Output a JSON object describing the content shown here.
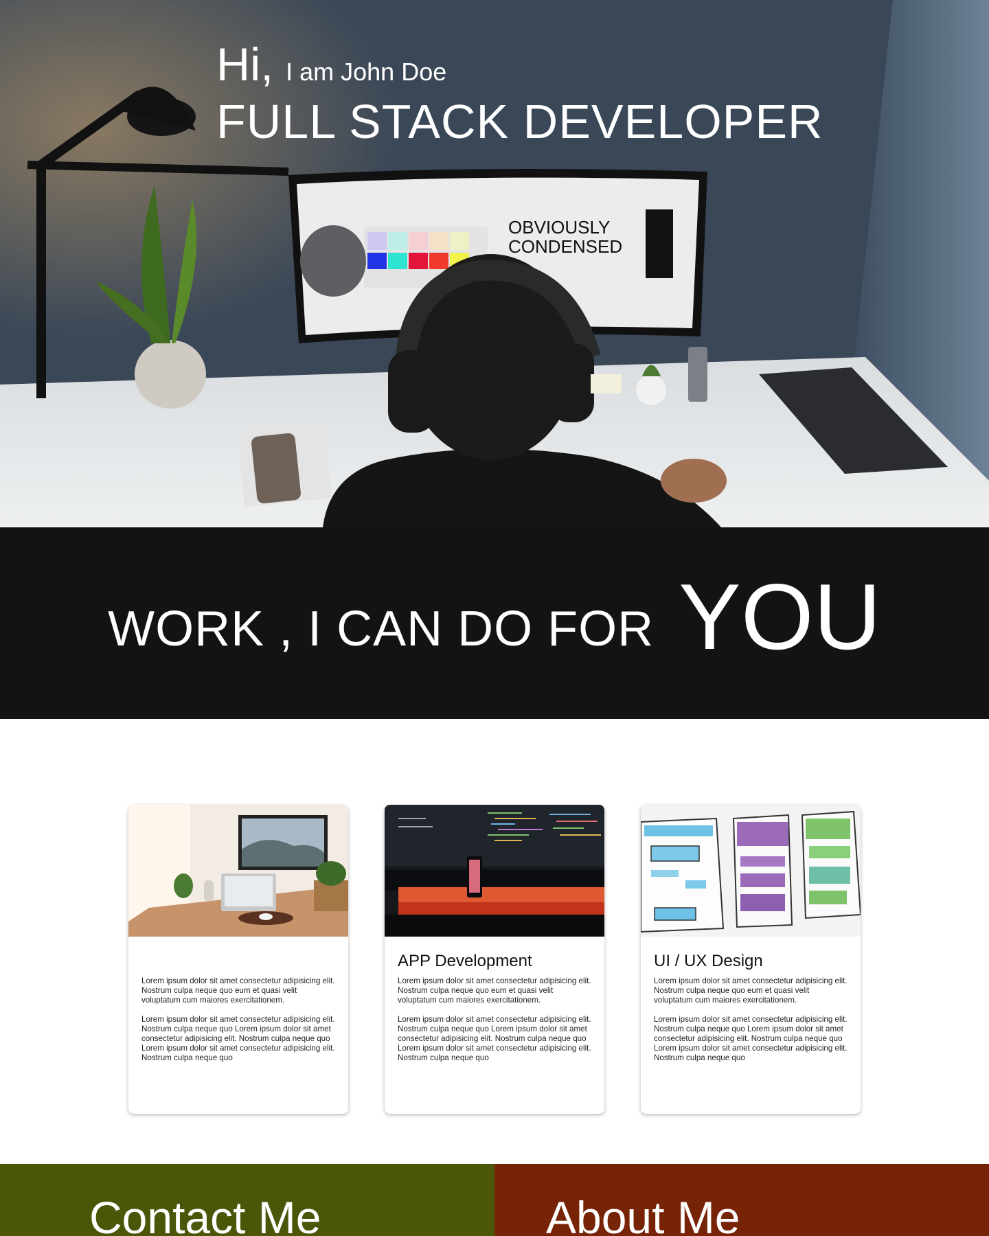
{
  "hero": {
    "hi": "Hi,",
    "name_line": "I am John Doe",
    "role": "FULL STACK DEVELOPER",
    "screen_text_line1": "OBVIOUSLY",
    "screen_text_line2": "CONDENSED"
  },
  "banner": {
    "lead": "WORK , I CAN DO FOR",
    "emphasis": "YOU"
  },
  "services": {
    "cards": [
      {
        "title": "",
        "para1": "Lorem ipsum dolor sit amet consectetur adipisicing elit. Nostrum culpa neque quo eum et quasi velit voluptatum cum maiores exercitationem.",
        "para2": "Lorem ipsum dolor sit amet consectetur adipisicing elit. Nostrum culpa neque quo Lorem ipsum dolor sit amet consectetur adipisicing elit. Nostrum culpa neque quo Lorem ipsum dolor sit amet consectetur adipisicing elit. Nostrum culpa neque quo"
      },
      {
        "title": "APP Development",
        "para1": "Lorem ipsum dolor sit amet consectetur adipisicing elit. Nostrum culpa neque quo eum et quasi velit voluptatum cum maiores exercitationem.",
        "para2": "Lorem ipsum dolor sit amet consectetur adipisicing elit. Nostrum culpa neque quo Lorem ipsum dolor sit amet consectetur adipisicing elit. Nostrum culpa neque quo Lorem ipsum dolor sit amet consectetur adipisicing elit. Nostrum culpa neque quo"
      },
      {
        "title": "UI / UX Design",
        "para1": "Lorem ipsum dolor sit amet consectetur adipisicing elit. Nostrum culpa neque quo eum et quasi velit voluptatum cum maiores exercitationem.",
        "para2": "Lorem ipsum dolor sit amet consectetur adipisicing elit. Nostrum culpa neque quo Lorem ipsum dolor sit amet consectetur adipisicing elit. Nostrum culpa neque quo Lorem ipsum dolor sit amet consectetur adipisicing elit. Nostrum culpa neque quo"
      }
    ]
  },
  "cta": {
    "contact_label": "Contact Me",
    "about_label": "About Me"
  },
  "colors": {
    "banner_bg": "#131316",
    "contact_bg": "#4b5609",
    "about_bg": "#772305"
  }
}
